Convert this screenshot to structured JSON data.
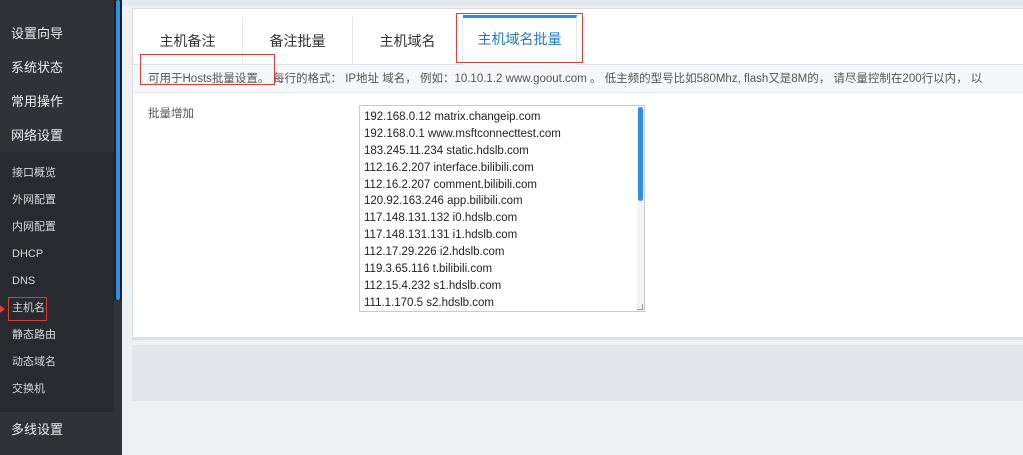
{
  "sidebar": {
    "top_items": [
      {
        "label": "设置向导"
      },
      {
        "label": "系统状态"
      },
      {
        "label": "常用操作"
      },
      {
        "label": "网络设置"
      }
    ],
    "sub_items": [
      {
        "label": "接口概览"
      },
      {
        "label": "外网配置"
      },
      {
        "label": "内网配置"
      },
      {
        "label": "DHCP"
      },
      {
        "label": "DNS"
      },
      {
        "label": "主机名"
      },
      {
        "label": "静态路由"
      },
      {
        "label": "动态域名"
      },
      {
        "label": "交换机"
      }
    ],
    "bottom_item": {
      "label": "多线设置"
    },
    "active_sub_item": "主机名"
  },
  "tabs": [
    {
      "label": "主机备注"
    },
    {
      "label": "备注批量"
    },
    {
      "label": "主机域名"
    },
    {
      "label": "主机域名批量"
    }
  ],
  "active_tab": "主机域名批量",
  "info": {
    "lead": "可用于Hosts批量设置。",
    "rest": "每行的格式： IP地址 域名， 例如：10.10.1.2 www.goout.com 。 低主频的型号比如580Mhz, flash又是8M的， 请尽量控制在200行以内， 以"
  },
  "form": {
    "label": "批量增加",
    "lines": [
      "192.168.0.12 matrix.changeip.com",
      "192.168.0.1 www.msftconnecttest.com",
      "183.245.11.234 static.hdslb.com",
      "112.16.2.207 interface.bilibili.com",
      "112.16.2.207 comment.bilibili.com",
      "120.92.163.246 app.bilibili.com",
      "117.148.131.132 i0.hdslb.com",
      "117.148.131.131 i1.hdslb.com",
      "112.17.29.226 i2.hdslb.com",
      "119.3.65.116 t.bilibili.com",
      "112.15.4.232 s1.hdslb.com",
      "111.1.170.5 s2.hdslb.com"
    ]
  },
  "colors": {
    "accent": "#2f8fe0",
    "highlight": "#d84040",
    "sidebar_bg": "#2f3338"
  }
}
